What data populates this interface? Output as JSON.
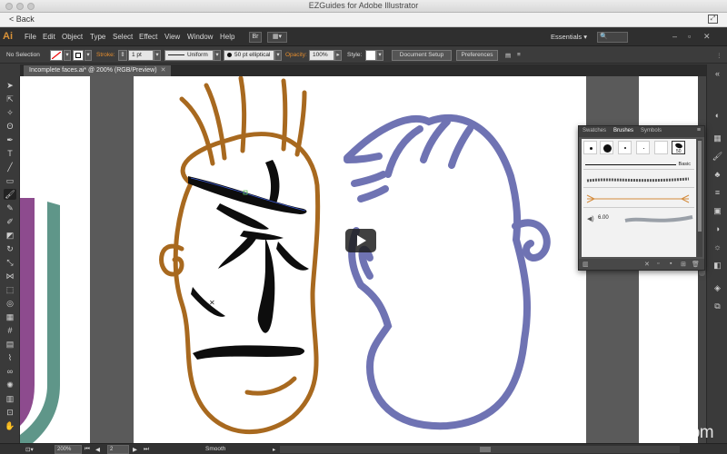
{
  "window": {
    "title": "EZGuides for Adobe Illustrator",
    "back_label": "Back"
  },
  "menubar": {
    "app_logo": "Ai",
    "items": [
      "File",
      "Edit",
      "Object",
      "Type",
      "Select",
      "Effect",
      "View",
      "Window",
      "Help"
    ],
    "br_button": "Br",
    "workspace": "Essentials"
  },
  "controlbar": {
    "selection": "No Selection",
    "stroke_label": "Stroke:",
    "stroke_weight": "1 pt",
    "profile": "Uniform",
    "brush": "50 pt elliptical",
    "opacity_label": "Opacity:",
    "opacity_value": "100%",
    "style_label": "Style:",
    "document_setup": "Document Setup",
    "preferences": "Preferences"
  },
  "document": {
    "tab_title": "Incomplete faces.ai* @ 200% (RGB/Preview)"
  },
  "brushes_panel": {
    "tabs": [
      "Swatches",
      "Brushes",
      "Symbols"
    ],
    "active_tab": "Brushes",
    "basic_label": "Basic",
    "selected_size": "50",
    "size_value": "6.00"
  },
  "statusbar": {
    "zoom": "200%",
    "artboard": "2",
    "tool": "Smooth"
  },
  "colors": {
    "orange_face": "#a8691f",
    "blue_face": "#6f73b3",
    "purple": "#8d4b8e",
    "teal": "#5f9689"
  },
  "watermark": "lynda.com"
}
